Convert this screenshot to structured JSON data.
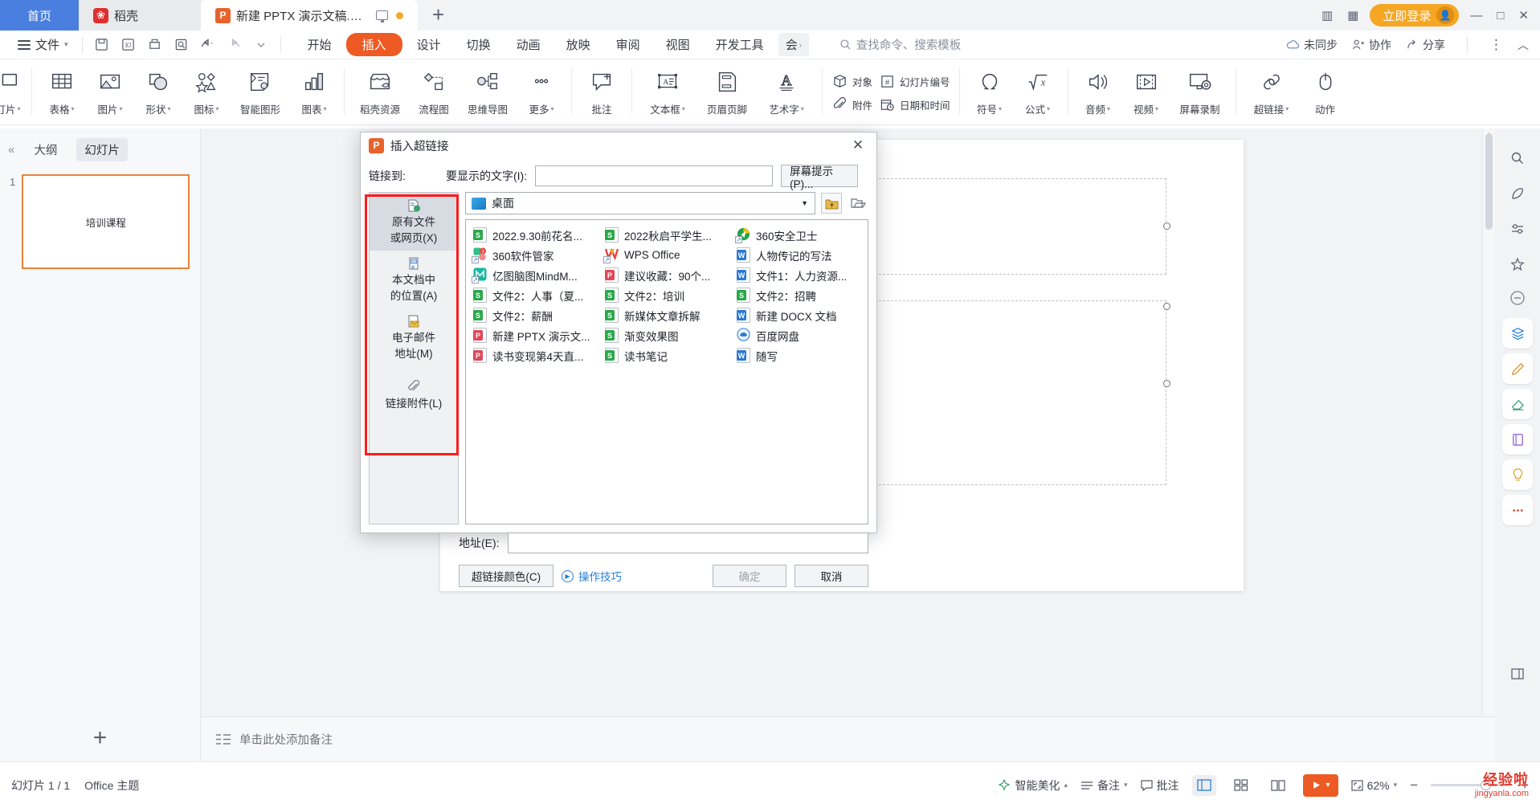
{
  "titlebar": {
    "tabs": [
      {
        "label": "首页",
        "type": "home"
      },
      {
        "label": "稻壳",
        "type": "docer",
        "icon": "docer-icon"
      },
      {
        "label": "新建 PPTX 演示文稿.pptx",
        "type": "active",
        "icon": "pptx-icon"
      }
    ],
    "new_tab_label": "+",
    "login_label": "立即登录",
    "win_min": "—",
    "win_max": "□",
    "win_close": "✕"
  },
  "menubar": {
    "file_label": "文件",
    "quick_access": [
      "save-icon",
      "save-as-icon",
      "print-icon",
      "print-preview-icon",
      "undo-icon",
      "redo-icon",
      "customize-icon"
    ],
    "ribbon_tabs": [
      {
        "label": "开始",
        "active": false
      },
      {
        "label": "插入",
        "active": true
      },
      {
        "label": "设计",
        "active": false
      },
      {
        "label": "切换",
        "active": false
      },
      {
        "label": "动画",
        "active": false
      },
      {
        "label": "放映",
        "active": false
      },
      {
        "label": "审阅",
        "active": false
      },
      {
        "label": "视图",
        "active": false
      },
      {
        "label": "开发工具",
        "active": false
      },
      {
        "label": "会",
        "active": false
      }
    ],
    "search_placeholder": "查找命令、搜索模板",
    "right_items": [
      {
        "label": "未同步",
        "icon": "cloud-icon"
      },
      {
        "label": "协作",
        "icon": "collaborate-icon"
      },
      {
        "label": "分享",
        "icon": "share-icon"
      }
    ],
    "more_label": "⋮",
    "collapse_label": "︿"
  },
  "ribbon": {
    "groups": [
      {
        "items": [
          {
            "label": "幻灯片",
            "icon": "new-slide-icon",
            "dropdown": true,
            "truncated": "灯片"
          }
        ]
      },
      {
        "items": [
          {
            "label": "表格",
            "icon": "table-icon",
            "dropdown": true
          },
          {
            "label": "图片",
            "icon": "picture-icon",
            "dropdown": true
          },
          {
            "label": "形状",
            "icon": "shapes-icon",
            "dropdown": true
          },
          {
            "label": "图标",
            "icon": "icons-icon",
            "dropdown": true
          },
          {
            "label": "智能图形",
            "icon": "smartart-icon",
            "dropdown": false
          },
          {
            "label": "图表",
            "icon": "chart-icon",
            "dropdown": true
          }
        ]
      },
      {
        "items": [
          {
            "label": "稻壳资源",
            "icon": "docer-store-icon",
            "dropdown": false
          },
          {
            "label": "流程图",
            "icon": "flowchart-icon",
            "dropdown": false
          },
          {
            "label": "思维导图",
            "icon": "mindmap-icon",
            "dropdown": false
          },
          {
            "label": "更多",
            "icon": "more-dots-icon",
            "dropdown": true
          }
        ]
      },
      {
        "items": [
          {
            "label": "批注",
            "icon": "comment-icon",
            "dropdown": false
          }
        ]
      },
      {
        "items": [
          {
            "label": "文本框",
            "icon": "textbox-icon",
            "dropdown": true
          },
          {
            "label": "页眉页脚",
            "icon": "header-footer-icon",
            "dropdown": false
          },
          {
            "label": "艺术字",
            "icon": "wordart-icon",
            "dropdown": true
          }
        ]
      },
      {
        "stacked": [
          {
            "label": "对象",
            "icon": "object-icon"
          },
          {
            "label": "附件",
            "icon": "attachment-icon"
          }
        ]
      },
      {
        "stacked": [
          {
            "label": "幻灯片编号",
            "icon": "slide-number-icon"
          },
          {
            "label": "日期和时间",
            "icon": "date-time-icon"
          }
        ]
      },
      {
        "items": [
          {
            "label": "符号",
            "icon": "symbol-icon",
            "dropdown": true
          },
          {
            "label": "公式",
            "icon": "equation-icon",
            "dropdown": true
          }
        ]
      },
      {
        "items": [
          {
            "label": "音频",
            "icon": "audio-icon",
            "dropdown": true
          },
          {
            "label": "视频",
            "icon": "video-icon",
            "dropdown": true
          },
          {
            "label": "屏幕录制",
            "icon": "screen-record-icon",
            "dropdown": false
          }
        ]
      },
      {
        "items": [
          {
            "label": "超链接",
            "icon": "hyperlink-icon",
            "dropdown": true
          },
          {
            "label": "动作",
            "icon": "action-icon",
            "dropdown": false
          }
        ]
      }
    ]
  },
  "outline": {
    "collapse_icon": "collapse-left-icon",
    "tab_outline": "大纲",
    "tab_slides": "幻灯片",
    "slide_number": "1",
    "slide_title": "培训课程",
    "add_slide_label": "+"
  },
  "notes": {
    "icon": "notes-icon",
    "placeholder": "单击此处添加备注"
  },
  "statusbar": {
    "slide_count": "幻灯片 1 / 1",
    "theme": "Office 主题",
    "beautify": "智能美化",
    "notes_btn": "备注",
    "comment_btn": "批注",
    "zoom_level": "62%",
    "minus": "−",
    "plus": "+",
    "watermark_line1": "经验啦",
    "watermark_line2": "jingyanla.com"
  },
  "dialog": {
    "title": "插入超链接",
    "icon": "pptx-icon",
    "close_label": "✕",
    "link_to_label": "链接到:",
    "display_text_label": "要显示的文字(I):",
    "display_text_value": "",
    "screen_tip_button": "屏幕提示(P)...",
    "sidebar_items": [
      {
        "label1": "原有文件",
        "label2": "或网页(X)",
        "icon": "existing-file-icon",
        "selected": true
      },
      {
        "label1": "本文档中",
        "label2": "的位置(A)",
        "icon": "place-in-document-icon",
        "selected": false
      },
      {
        "label1": "电子邮件",
        "label2": "地址(M)",
        "icon": "email-address-icon",
        "selected": false
      },
      {
        "label1": "链接附件(L)",
        "label2": "",
        "icon": "attachment-link-icon",
        "selected": false
      }
    ],
    "location_value": "桌面",
    "location_icon": "desktop-icon",
    "up_folder_icon": "up-folder-icon",
    "browse_folder_icon": "browse-folder-icon",
    "files": [
      {
        "name": "2022.9.30前花名...",
        "type": "et"
      },
      {
        "name": "2022秋启平学生...",
        "type": "et"
      },
      {
        "name": "360安全卫士",
        "type": "360safe"
      },
      {
        "name": "360软件管家",
        "type": "360soft"
      },
      {
        "name": "WPS Office",
        "type": "wps"
      },
      {
        "name": "人物传记的写法",
        "type": "doc"
      },
      {
        "name": "亿图脑图MindM...",
        "type": "mindmaster"
      },
      {
        "name": "建议收藏：90个...",
        "type": "ppt"
      },
      {
        "name": "文件1：人力资源...",
        "type": "doc"
      },
      {
        "name": "文件2：人事（夏...",
        "type": "et"
      },
      {
        "name": "文件2：培训",
        "type": "et"
      },
      {
        "name": "文件2：招聘",
        "type": "et"
      },
      {
        "name": "文件2：薪酬",
        "type": "et"
      },
      {
        "name": "新媒体文章拆解",
        "type": "et"
      },
      {
        "name": "新建 DOCX 文档",
        "type": "doc"
      },
      {
        "name": "新建 PPTX 演示文...",
        "type": "ppt"
      },
      {
        "name": "渐变效果图",
        "type": "et"
      },
      {
        "name": "百度网盘",
        "type": "baidu"
      },
      {
        "name": "读书变现第4天直...",
        "type": "ppt"
      },
      {
        "name": "读书笔记",
        "type": "et"
      },
      {
        "name": "随写",
        "type": "doc"
      }
    ],
    "address_label": "地址(E):",
    "address_value": "",
    "hyperlink_color_button": "超链接颜色(C)",
    "tips_link": "操作技巧",
    "ok_button": "确定",
    "cancel_button": "取消"
  },
  "colors": {
    "accent_orange": "#ee5a24",
    "home_blue": "#4a7fe0",
    "login_amber": "#f5a623",
    "highlight_red": "#fe1b1b",
    "link_blue": "#2a7fd4"
  }
}
